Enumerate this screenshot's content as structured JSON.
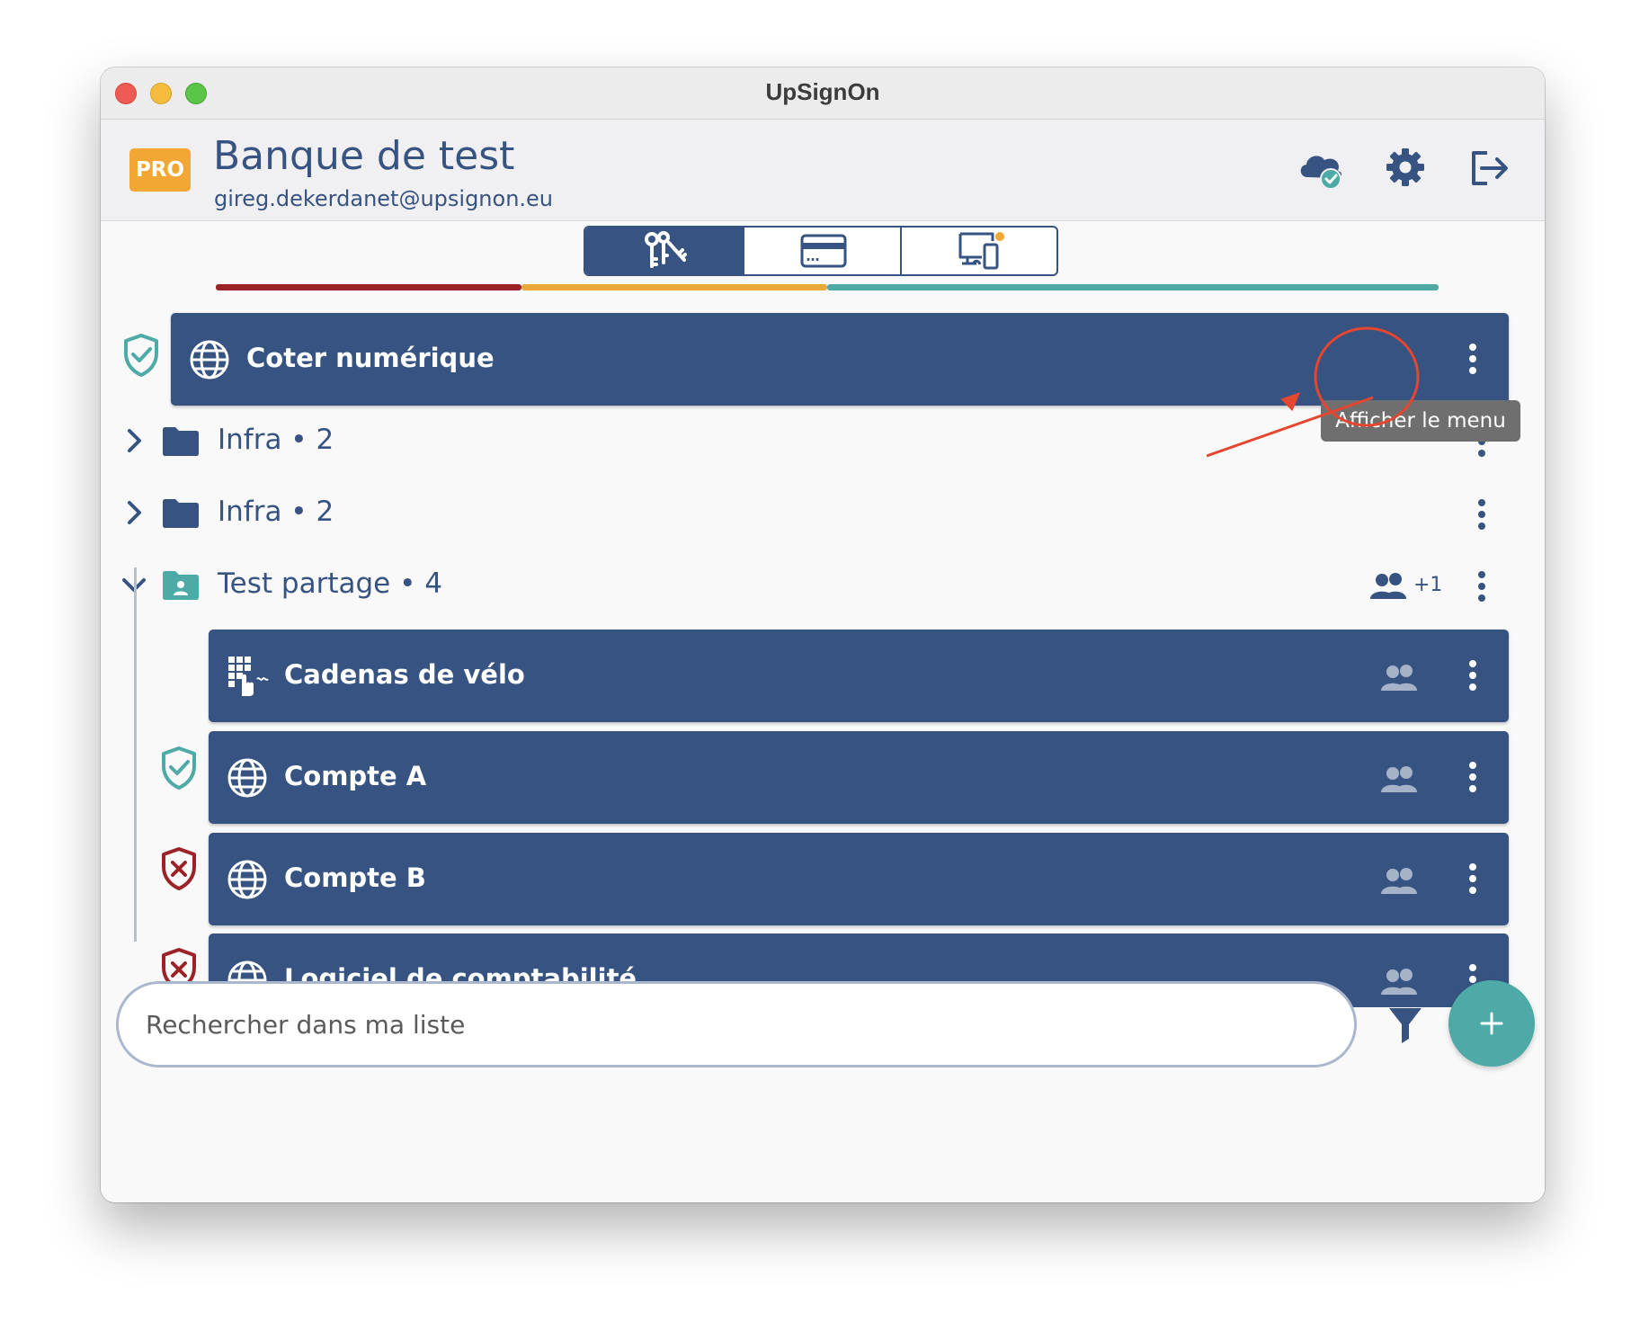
{
  "window": {
    "title": "UpSignOn"
  },
  "header": {
    "badge": "PRO",
    "bank_name": "Banque de test",
    "email": "gireg.dekerdanet@upsignon.eu",
    "icons": [
      "cloud-sync-icon",
      "gear-icon",
      "logout-icon"
    ]
  },
  "tabs": [
    {
      "icon": "keys-icon",
      "active": true
    },
    {
      "icon": "credit-card-icon",
      "active": false
    },
    {
      "icon": "devices-icon",
      "active": false,
      "notification": true
    }
  ],
  "strength_bar": {
    "colors": [
      "#9b2226",
      "#eaa83a",
      "#4ea8a4"
    ],
    "fractions": [
      0.25,
      0.25,
      0.5
    ]
  },
  "items": {
    "coter": {
      "label": "Coter numérique",
      "status": "secure"
    },
    "infra1": {
      "label": "Infra • 2"
    },
    "infra2": {
      "label": "Infra • 2"
    },
    "test_partage": {
      "label": "Test partage • 4",
      "shared_extra": "+1"
    },
    "cadenas": {
      "label": "Cadenas de vélo"
    },
    "compte_a": {
      "label": "Compte A",
      "status": "secure"
    },
    "compte_b": {
      "label": "Compte B",
      "status": "weak"
    },
    "logiciel": {
      "label": "Logiciel de comptabilité",
      "status": "weak"
    }
  },
  "tooltip": {
    "text": "Afficher le menu"
  },
  "search": {
    "placeholder": "Rechercher dans ma liste"
  },
  "colors": {
    "primary": "#365382",
    "teal": "#4eaaa6",
    "danger": "#9b2226",
    "warning": "#f2a735",
    "annotation": "#e4462f"
  }
}
